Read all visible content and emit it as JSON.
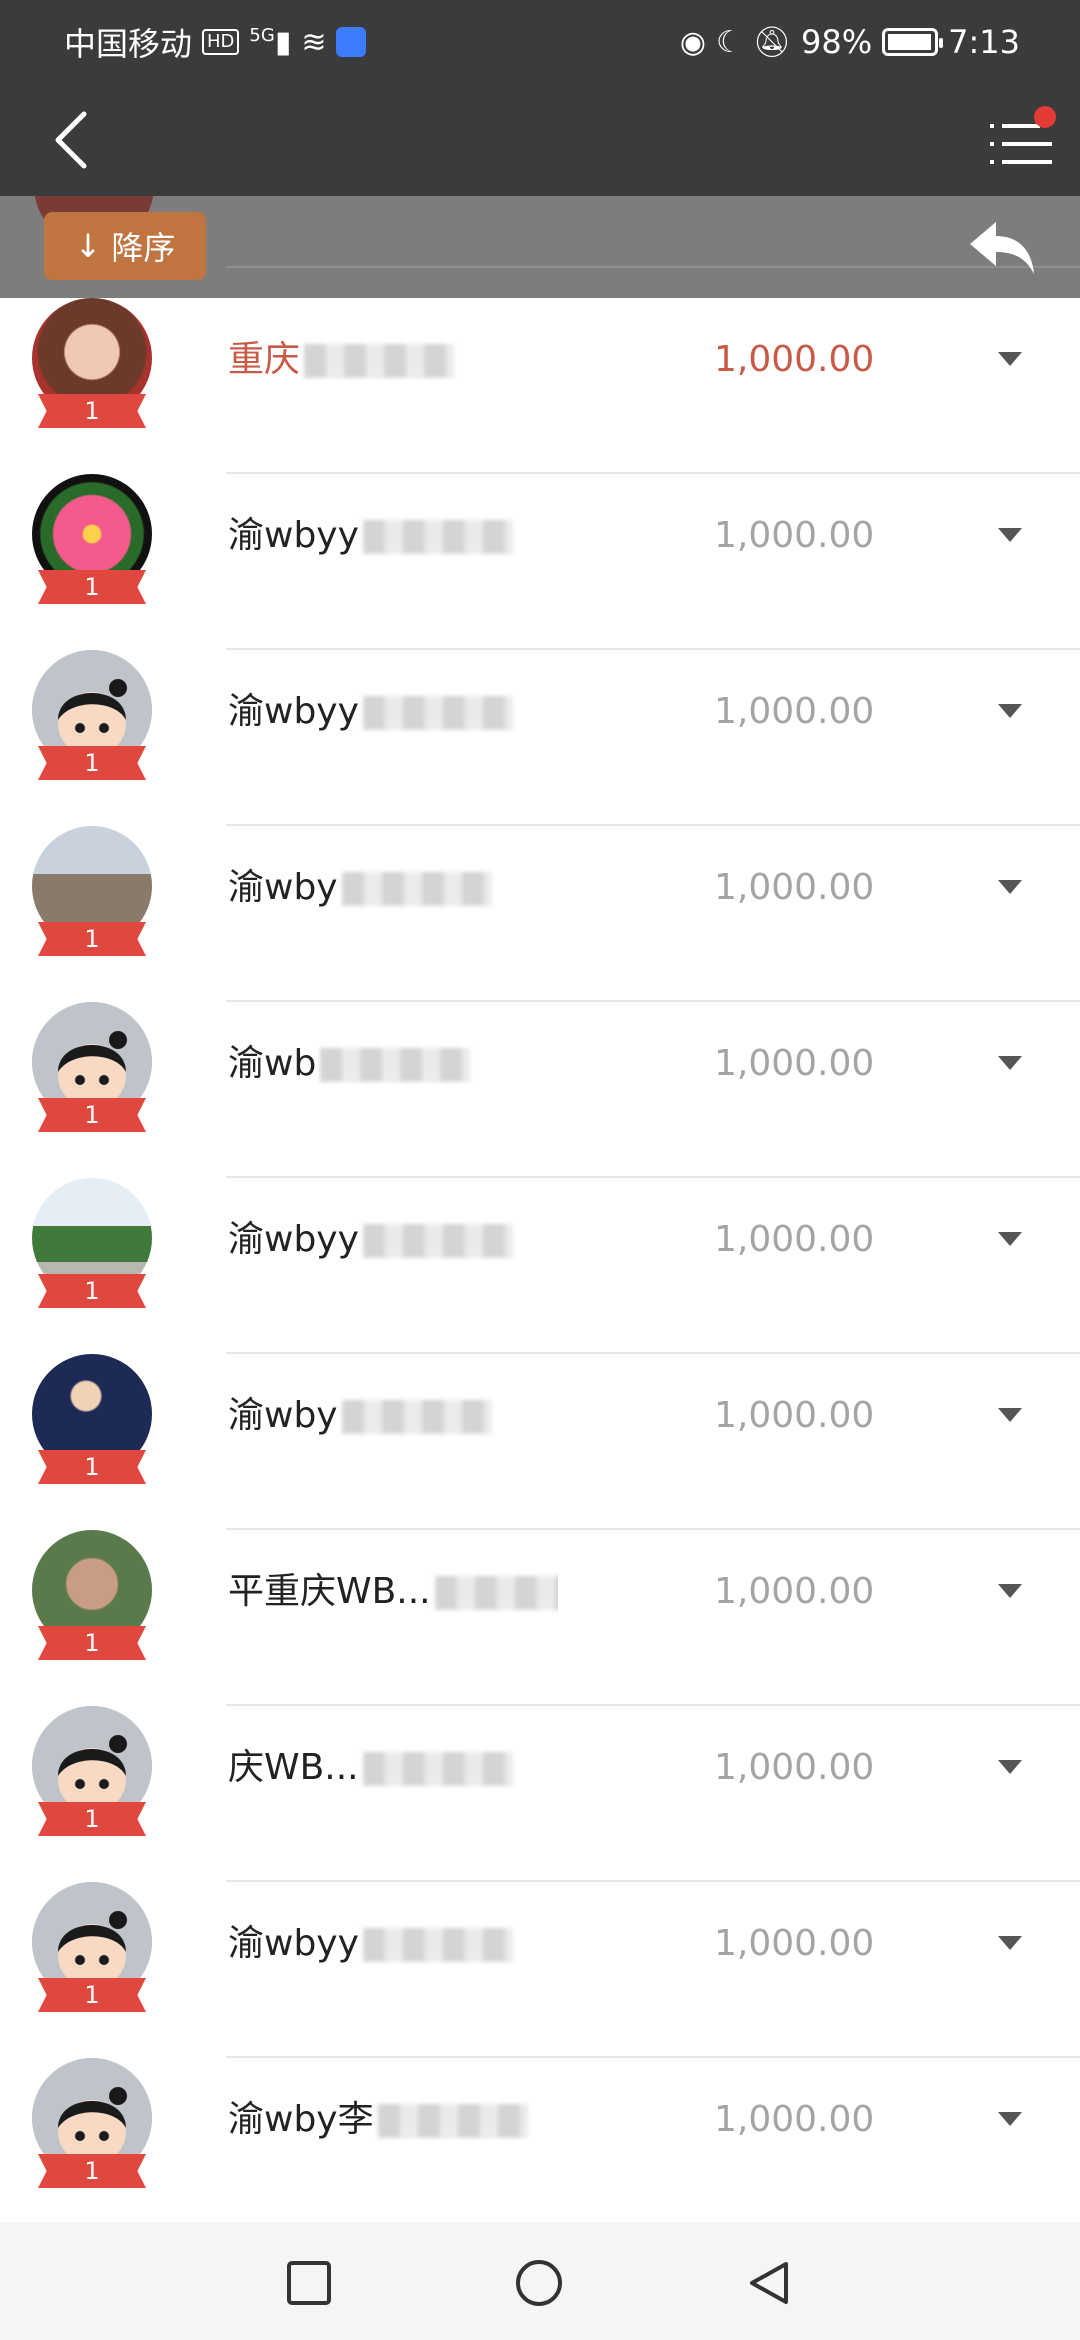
{
  "status_bar": {
    "carrier": "中国移动",
    "hd_badge": "HD",
    "network": "5G",
    "battery_percent": "98%",
    "battery_level": 0.98,
    "time": "7:13"
  },
  "sort_button": {
    "label": "降序",
    "icon": "arrow-down-icon"
  },
  "rows": [
    {
      "rank": "1",
      "name_visible": "重庆",
      "amount": "1,000.00",
      "highlight": true
    },
    {
      "rank": "1",
      "name_visible": "渝wbyy",
      "amount": "1,000.00"
    },
    {
      "rank": "1",
      "name_visible": "渝wbyy",
      "amount": "1,000.00"
    },
    {
      "rank": "1",
      "name_visible": "渝wby",
      "amount": "1,000.00"
    },
    {
      "rank": "1",
      "name_visible": "渝wb",
      "amount": "1,000.00"
    },
    {
      "rank": "1",
      "name_visible": "渝wbyy",
      "amount": "1,000.00"
    },
    {
      "rank": "1",
      "name_visible": "渝wby",
      "amount": "1,000.00"
    },
    {
      "rank": "1",
      "name_visible": "平重庆WB...",
      "amount": "1,000.00"
    },
    {
      "rank": "1",
      "name_visible": "庆WB...",
      "amount": "1,000.00"
    },
    {
      "rank": "1",
      "name_visible": "渝wbyy",
      "amount": "1,000.00"
    },
    {
      "rank": "1",
      "name_visible": "渝wby李",
      "amount": "1,000.00"
    }
  ],
  "icons": {
    "back": "chevron-left-icon",
    "menu": "menu-icon",
    "reply": "reply-icon",
    "caret": "caret-down-icon",
    "recents": "square-icon",
    "home": "circle-icon",
    "back_nav": "triangle-back-icon"
  },
  "colors": {
    "bar_dark": "#3a3b3d",
    "sort_bg": "#c0743f",
    "highlight": "#c85a48",
    "amount_gray": "#a4a4a4",
    "ribbon_red": "#e0473e",
    "notify_dot": "#e33a33"
  }
}
